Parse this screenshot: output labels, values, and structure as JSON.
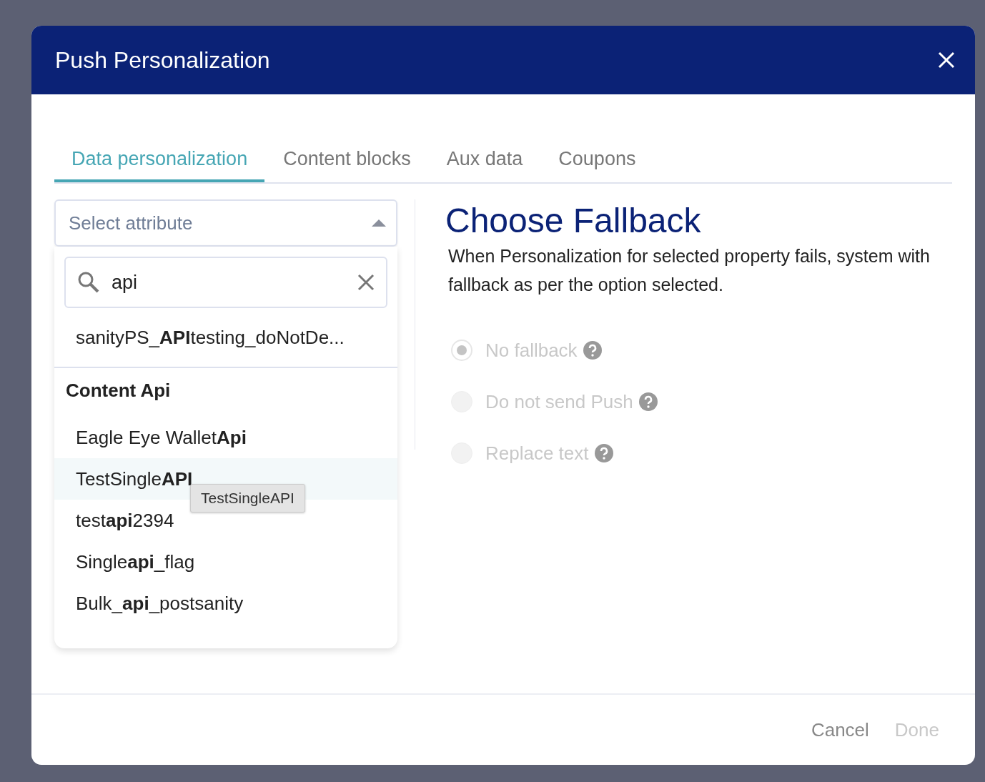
{
  "dialog": {
    "title": "Push Personalization"
  },
  "tabs": [
    {
      "label": "Data personalization",
      "selected": true
    },
    {
      "label": "Content blocks",
      "selected": false
    },
    {
      "label": "Aux data",
      "selected": false
    },
    {
      "label": "Coupons",
      "selected": false
    }
  ],
  "attribute_select": {
    "placeholder": "Select attribute",
    "expanded": true,
    "search": {
      "value": "api"
    },
    "ungrouped_items": [
      {
        "label": "sanityPS_**API**testing_doNotDe...",
        "highlighted": false
      }
    ],
    "groups": [
      {
        "title": "Content Api",
        "items": [
          {
            "label": "Eagle Eye Wallet**Api**",
            "highlighted": false
          },
          {
            "label": "TestSingle**API**",
            "highlighted": true
          },
          {
            "label": "test**api**2394",
            "highlighted": false
          },
          {
            "label": "Single**api**_flag",
            "highlighted": false
          },
          {
            "label": "Bulk_**api**_postsanity",
            "highlighted": false
          }
        ]
      }
    ],
    "tooltip": "TestSingleAPI"
  },
  "fallback": {
    "title": "Choose Fallback",
    "description": "When Personalization for selected property fails, system with fallback as per the option selected.",
    "options": [
      {
        "label": "No fallback",
        "selected": true,
        "disabled": true
      },
      {
        "label": "Do not send Push",
        "selected": false,
        "disabled": true
      },
      {
        "label": "Replace text",
        "selected": false,
        "disabled": true
      }
    ]
  },
  "footer": {
    "buttons": [
      {
        "label": "Cancel",
        "disabled": false
      },
      {
        "label": "Done",
        "disabled": true
      }
    ]
  }
}
